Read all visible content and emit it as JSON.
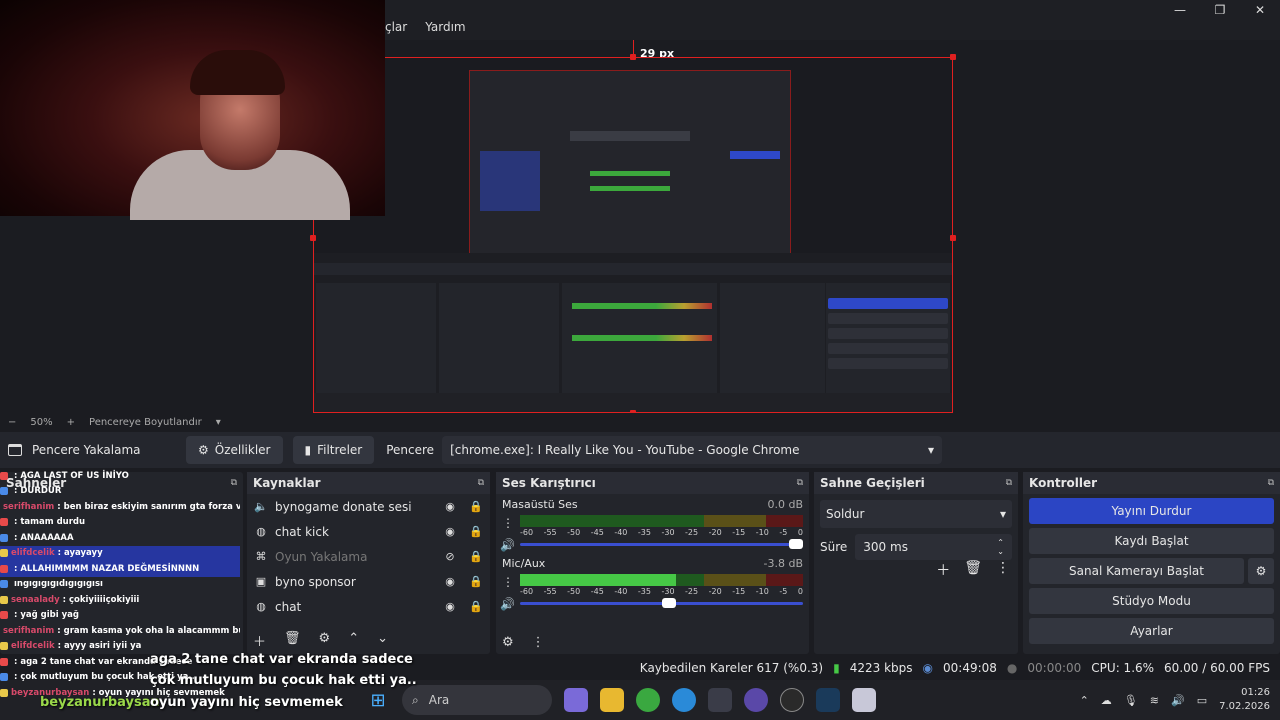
{
  "menubar": {
    "items": [
      "çlar",
      "Yardım"
    ]
  },
  "window_controls": {
    "minimize": "—",
    "maximize": "❐",
    "close": "✕"
  },
  "preview": {
    "guide_label": "29 px"
  },
  "zoom": {
    "minus": "−",
    "value": "50%",
    "plus": "+",
    "fit_label": "Pencereye Boyutlandır",
    "dropdown": "▾"
  },
  "source_bar": {
    "source_name": "Pencere Yakalama",
    "properties_label": "Özellikler",
    "filters_label": "Filtreler",
    "window_label": "Pencere",
    "window_value": "[chrome.exe]: I Really Like You - YouTube - Google Chrome"
  },
  "scenes": {
    "title": "Sahneler"
  },
  "sources": {
    "title": "Kaynaklar",
    "items": [
      {
        "icon": "speaker-icon",
        "name": "bynogame donate sesi",
        "dim": false
      },
      {
        "icon": "globe-icon",
        "name": "chat kick",
        "dim": false
      },
      {
        "icon": "gamepad-icon",
        "name": "Oyun Yakalama",
        "dim": true
      },
      {
        "icon": "image-icon",
        "name": "byno sponsor",
        "dim": false
      },
      {
        "icon": "globe-icon",
        "name": "chat",
        "dim": false
      }
    ]
  },
  "mixer": {
    "title": "Ses Karıştırıcı",
    "channels": [
      {
        "name": "Masaüstü Ses",
        "db": "0.0 dB",
        "level": 0.0
      },
      {
        "name": "Mic/Aux",
        "db": "-3.8 dB",
        "level": 0.55
      }
    ],
    "ticks": [
      "-60",
      "-55",
      "-50",
      "-45",
      "-40",
      "-35",
      "-30",
      "-25",
      "-20",
      "-15",
      "-10",
      "-5",
      "0"
    ]
  },
  "transitions": {
    "title": "Sahne Geçişleri",
    "type": "Soldur",
    "duration_label": "Süre",
    "duration_value": "300 ms"
  },
  "controls": {
    "title": "Kontroller",
    "stop_stream": "Yayını Durdur",
    "start_recording": "Kaydı Başlat",
    "virtual_camera": "Sanal Kamerayı Başlat",
    "studio_mode": "Stüdyo Modu",
    "settings": "Ayarlar"
  },
  "status": {
    "dropped_frames": "Kaybedilen Kareler 617 (%0.3)",
    "bitrate": "4223 kbps",
    "stream_time": "00:49:08",
    "record_time": "00:00:00",
    "cpu": "CPU: 1.6%",
    "fps": "60.00 / 60.00 FPS"
  },
  "taskbar": {
    "search_placeholder": "Ara",
    "time": "01:26",
    "date": "7.02.2026"
  },
  "chat": {
    "lines": [
      {
        "user": "",
        "text": ": AGA LAST OF US İNİYO"
      },
      {
        "user": "",
        "text": ": DURDUR"
      },
      {
        "user": "serifhanim",
        "text": ": ben biraz eskiyim sanırım gta forza ve cs go oynuyorum"
      },
      {
        "user": "",
        "text": ": tamam durdu"
      },
      {
        "user": "",
        "text": ": ANAAAAAA"
      },
      {
        "user": "elifdcelik",
        "text": ": ayayayy"
      },
      {
        "user": "",
        "text": ": ALLAHIMMMM NAZAR DEĞMESİNNNN"
      },
      {
        "user": "",
        "text": "ıngıgıgıgıdıgıgıgısı"
      },
      {
        "user": "senaalady",
        "text": ": çokiyiiiiçokiyiii"
      },
      {
        "user": "",
        "text": ": yağ gibi yağ"
      },
      {
        "user": "serifhanim",
        "text": ": gram kasma yok oha la alacammm bu bilgisayarı"
      },
      {
        "user": "elifdcelik",
        "text": ": ayyy asiri iyii ya"
      },
      {
        "user": "",
        "text": ": aga 2 tane chat var ekranda sadece"
      },
      {
        "user": "",
        "text": ": çok mutluyum bu çocuk hak etti ya.."
      },
      {
        "user": "beyzanurbaysan",
        "text": ": oyun yayını hiç sevmemek"
      }
    ],
    "overlay_1": "aga 2 tane chat var ekranda sadece",
    "overlay_2": "çok mutluyum bu çocuk hak etti ya..",
    "overlay_user": "beyzanurbaysan",
    "overlay_3": "oyun yayını hiç sevmemek"
  },
  "colors": {
    "accent": "#2b45c4",
    "selection": "#e02020",
    "bg": "#1b1c21"
  }
}
